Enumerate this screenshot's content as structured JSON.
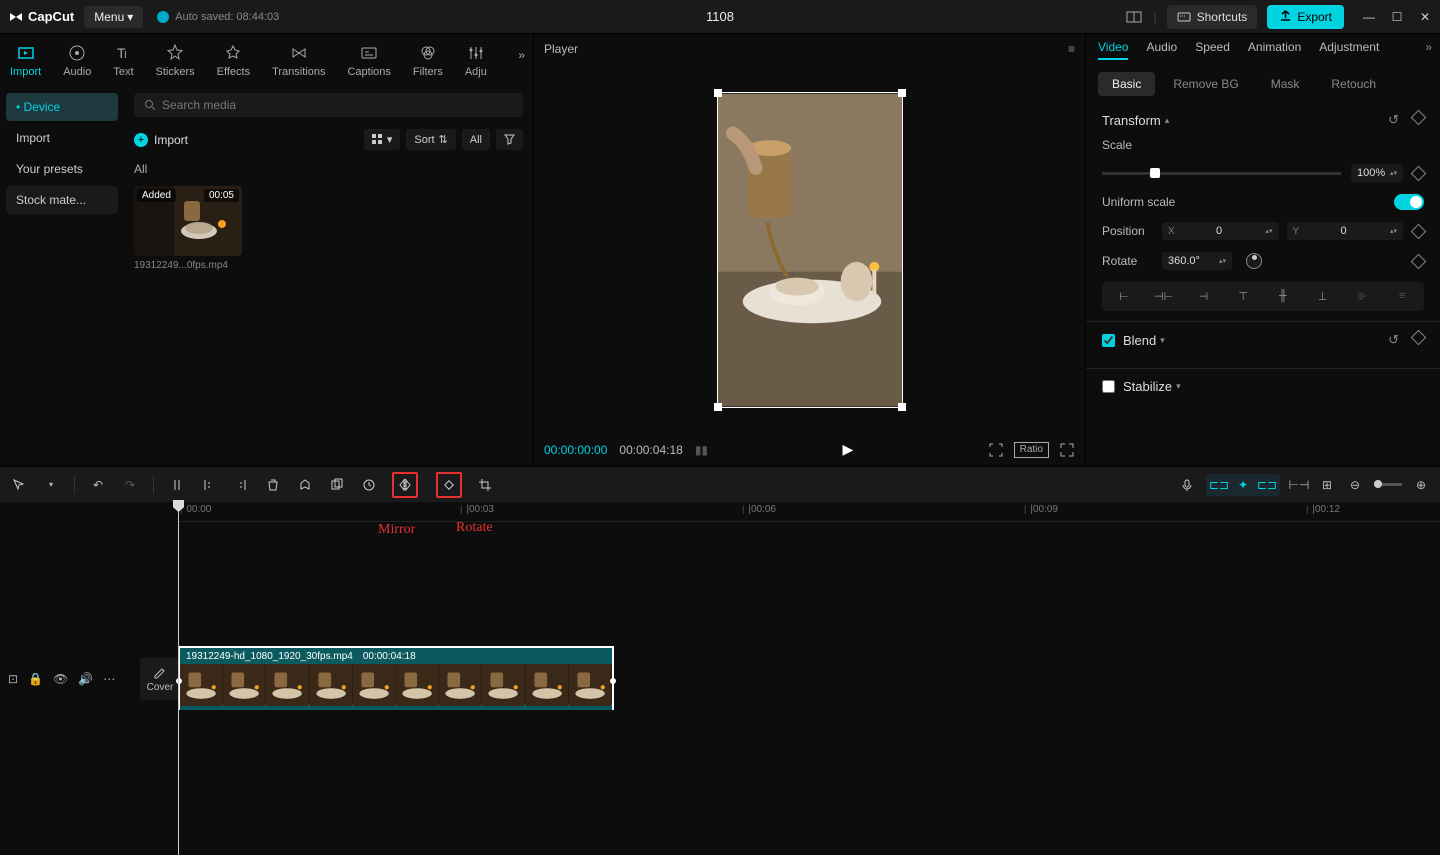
{
  "titlebar": {
    "app": "CapCut",
    "menu": "Menu",
    "autosave": "Auto saved: 08:44:03",
    "project": "1108",
    "shortcuts": "Shortcuts",
    "export": "Export"
  },
  "topTabs": [
    "Import",
    "Audio",
    "Text",
    "Stickers",
    "Effects",
    "Transitions",
    "Captions",
    "Filters",
    "Adju"
  ],
  "sideNav": [
    "Device",
    "Import",
    "Your presets",
    "Stock mate..."
  ],
  "media": {
    "searchPlaceholder": "Search media",
    "importLabel": "Import",
    "sort": "Sort",
    "all": "All",
    "filterAll": "All",
    "thumb": {
      "added": "Added",
      "dur": "00:05",
      "name": "19312249...0fps.mp4"
    }
  },
  "player": {
    "title": "Player",
    "cur": "00:00:00:00",
    "tot": "00:00:04:18",
    "ratio": "Ratio"
  },
  "rightPanel": {
    "tabs": [
      "Video",
      "Audio",
      "Speed",
      "Animation",
      "Adjustment"
    ],
    "subTabs": [
      "Basic",
      "Remove BG",
      "Mask",
      "Retouch"
    ],
    "transform": "Transform",
    "scale": "Scale",
    "scaleVal": "100%",
    "uniform": "Uniform scale",
    "position": "Position",
    "posX": "0",
    "posY": "0",
    "rotate": "Rotate",
    "rotateVal": "360.0°",
    "blend": "Blend",
    "stabilize": "Stabilize"
  },
  "annotations": {
    "mirror": "Mirror",
    "rotate": "Rotate"
  },
  "timeline": {
    "ticks": [
      "00:00",
      "|00:03",
      "|00:06",
      "|00:09",
      "|00:12"
    ],
    "clipName": "19312249-hd_1080_1920_30fps.mp4",
    "clipDur": "00:00:04:18",
    "cover": "Cover"
  }
}
